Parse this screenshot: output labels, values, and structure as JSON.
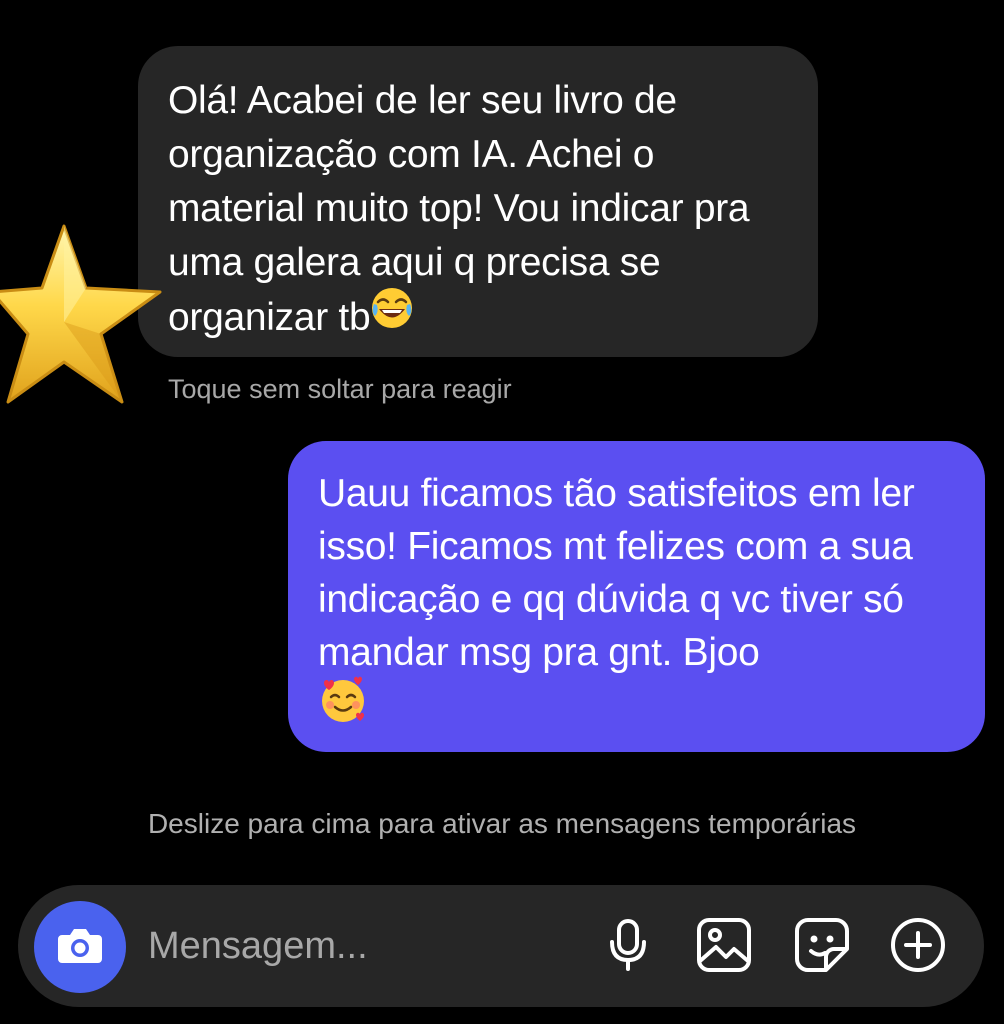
{
  "conversation": {
    "incoming": {
      "text": "Olá! Acabei de ler seu livro de organização com IA. Achei o material muito top! Vou indicar pra uma galera aqui q precisa se organizar tb",
      "emoji": "face-with-tears-of-joy",
      "reaction": "star",
      "hint": "Toque sem soltar para reagir"
    },
    "outgoing": {
      "text": "Uauu ficamos tão satisfeitos em ler isso! Ficamos mt felizes com a sua indicação e qq dúvida q vc tiver só mandar msg pra gnt. Bjoo",
      "emoji": "smiling-face-with-hearts"
    },
    "vanish_mode_hint": "Deslize para cima para ativar as mensagens temporárias"
  },
  "composer": {
    "placeholder": "Mensagem...",
    "icons": [
      "camera-icon",
      "microphone-icon",
      "gallery-icon",
      "sticker-icon",
      "plus-icon"
    ]
  },
  "colors": {
    "background": "#000000",
    "incoming_bubble": "#262626",
    "outgoing_bubble": "#5b4ff1",
    "camera_button": "#4a62ee",
    "hint_text": "#a8a8a8"
  }
}
